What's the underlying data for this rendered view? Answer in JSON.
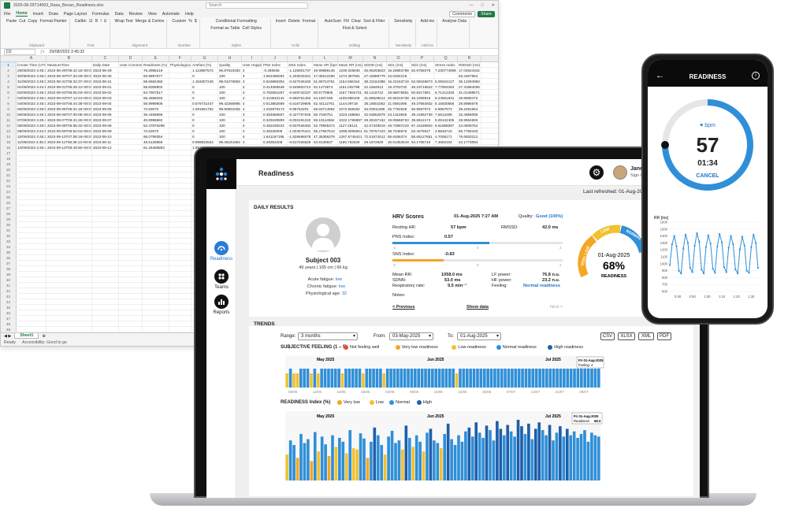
{
  "excel": {
    "file_title": "2025-08-29T14003_Rasa_Bevan_Readiness.xlsx",
    "search_placeholder": "Search",
    "menu_tabs": [
      "File",
      "Home",
      "Insert",
      "Draw",
      "Page Layout",
      "Formulas",
      "Data",
      "Review",
      "View",
      "Automate",
      "Help"
    ],
    "active_tab": "Home",
    "comments_label": "Comments",
    "share_label": "Share",
    "ribbon": [
      {
        "group": "Clipboard",
        "items": [
          "Paste",
          "Cut",
          "Copy",
          "Format Painter"
        ]
      },
      {
        "group": "Font",
        "items": [
          "Calibri",
          "11",
          "B",
          "I",
          "U"
        ]
      },
      {
        "group": "Alignment",
        "items": [
          "Wrap Text",
          "Merge & Centre"
        ]
      },
      {
        "group": "Number",
        "items": [
          "Custom",
          "%",
          "$"
        ]
      },
      {
        "group": "Styles",
        "items": [
          "Conditional Formatting",
          "Format as Table",
          "Cell Styles"
        ]
      },
      {
        "group": "Cells",
        "items": [
          "Insert",
          "Delete",
          "Format"
        ]
      },
      {
        "group": "Editing",
        "items": [
          "AutoSum",
          "Fill",
          "Clear",
          "Sort & Filter",
          "Find & Select"
        ]
      },
      {
        "group": "Sensitivity",
        "items": [
          "Sensitivity"
        ]
      },
      {
        "group": "Add-ins",
        "items": [
          "Add-ins"
        ]
      },
      {
        "group": "",
        "items": [
          "Analyse Data"
        ]
      }
    ],
    "name_box": "D2",
    "formula": "29/08/2023 3:45:32",
    "columns": [
      "A",
      "B",
      "C",
      "D",
      "E",
      "F",
      "G",
      "H",
      "I",
      "J",
      "K",
      "L",
      "M",
      "N",
      "O",
      "P",
      "Q",
      "R",
      "S",
      "T"
    ],
    "headers": [
      "Create Time (UTC)",
      "MeasureTime",
      "Daily Date",
      "User Comment",
      "Readiness (%)",
      "Physiological",
      "Artefact (%)",
      "Quality",
      "User Happiness",
      "PNS Index",
      "SNS Index",
      "Mean HR (bpm)",
      "Mean RR (ms)",
      "SDNN (ms)",
      "SD1 (ms)",
      "SD2 (ms)",
      "Stress Index",
      "RMSSD (ms)"
    ],
    "rows": [
      [
        "29/08/2023 3:45:32",
        "2023-08-29T06:42:15+00:00",
        "2023-08-29",
        "",
        "76.2955219",
        "",
        "1.123897572",
        "96.87610283",
        "4",
        "-0.256936",
        "-1.126001737",
        "49.99888146",
        "1200.026946",
        "45.66293823",
        "16.26883788",
        "62.8755078",
        "7.230774908",
        "17.04624342"
      ],
      [
        "30/08/2023 3:45:04",
        "2023-08-30T07:34:29+00:00",
        "2023-08-30",
        "",
        "93.8897677",
        "",
        "0",
        "100",
        "4",
        "1.562496294",
        "-1.333015341",
        "47.08212256",
        "1274.387591",
        "27.42588779",
        "34.0264218",
        "",
        "",
        "53.4467564"
      ],
      [
        "31/08/2023 3:45:56",
        "2023-08-31T06:32:37+00:00",
        "2023-08-31",
        "",
        "59.6662465",
        "",
        "1.153307245",
        "99.04276963",
        "4",
        "0.616896304",
        "-0.627046183",
        "51.96724761",
        "1154.556154",
        "38.22164388",
        "16.22163719",
        "52.09165873",
        "8.05024127",
        "36.12294983"
      ],
      [
        "01/09/2023 3:44:18",
        "2023-09-01T06:28:12+00:00",
        "2023-09-01",
        "",
        "55.6008802",
        "",
        "0",
        "100",
        "4",
        "0.414065548",
        "-0.546603714",
        "52.1273874",
        "1151.032798",
        "22.1664812",
        "19.3703732",
        "46.23716622",
        "7.77904283",
        "27.31864006"
      ],
      [
        "02/09/2023 3:45:14",
        "2023-09-02T06:55:03+00:00",
        "2023-09-02",
        "",
        "64.7907517",
        "",
        "0",
        "100",
        "4",
        "0.782591257",
        "-0.949742237",
        "50.5770806",
        "1157.7692731",
        "45.1418742",
        "28.98076851",
        "60.8217891",
        "6.71412348",
        "41.01488671"
      ],
      [
        "03/09/2023 3:45:09",
        "2023-09-03T07:12:44+00:00",
        "2023-09-03",
        "",
        "55.4558293",
        "",
        "0",
        "100",
        "4",
        "0.410532142",
        "-0.658761452",
        "54.1507195",
        "1108.858109",
        "31.89629614",
        "20.69316738",
        "46.1009816",
        "8.24561931",
        "28.8869473"
      ],
      [
        "04/09/2023 3:45:06",
        "2023-09-04T06:44:38+00:00",
        "2023-09-04",
        "",
        "58.9999806",
        "",
        "0.576731447",
        "99.42266995",
        "4",
        "0.613862689",
        "-0.616729605",
        "52.44112761",
        "1144.09718",
        "38.18501562",
        "21.0681095",
        "49.37684932",
        "8.15930656",
        "29.8986679"
      ],
      [
        "05/09/2023 3:45:52",
        "2023-09-05T06:31:18+00:00",
        "2023-09-05",
        "",
        "72.63070",
        "",
        "1.091661752",
        "98.90831025",
        "4",
        "1.032876173",
        "-0.98764201",
        "55.83714952",
        "1072.558462",
        "45.00611008",
        "25.7762628",
        "66.9687573",
        "6.8867573",
        "39.2291654"
      ],
      [
        "06/09/2023 3:45:12",
        "2023-09-06T07:00:05+00:00",
        "2023-09-06",
        "",
        "36.4469696",
        "",
        "0",
        "100",
        "4",
        "0.284565507",
        "-0.427707045",
        "60.7040751",
        "1023.168864",
        "32.63552879",
        "23.1310849",
        "39.41982739",
        "7.5612499",
        "33.4958096"
      ],
      [
        "07/09/2023 3:45:41",
        "2023-09-07T06:41:26+00:00",
        "2023-09-07",
        "",
        "40.8995682",
        "",
        "0",
        "100",
        "4",
        "0.329190809",
        "-0.003191222",
        "59.10114562",
        "1022.1765897",
        "29.28197152",
        "19.05568723",
        "39.6612174",
        "9.29122405",
        "26.9554693"
      ],
      [
        "08/09/2023 3:45:08",
        "2023-09-08T06:56:32+00:00",
        "2023-09-08",
        "",
        "52.47876298",
        "",
        "0",
        "100",
        "4",
        "0.482190222",
        "-0.837636462",
        "52.78905374",
        "1127.46121",
        "42.67349519",
        "29.73997219",
        "57.16186504",
        "6.61868097",
        "42.0608764"
      ],
      [
        "09/09/2023 3:44:50",
        "2023-09-09T06:52:04+00:00",
        "2023-09-09",
        "",
        "72.63070",
        "",
        "0",
        "100",
        "4",
        "0.48226009",
        "-1.004675421",
        "55.27567613",
        "1098.0006601",
        "51.78767103",
        "38.7048876",
        "53.4076547",
        "4.8845716",
        "55.7765433"
      ],
      [
        "10/09/2023 3:45:23",
        "2023-09-10T07:06:18+00:00",
        "2023-09-10",
        "",
        "95.0799354",
        "",
        "0",
        "100",
        "4",
        "1.641167195",
        "-1.526698078",
        "47.35356378",
        "1267.6745421",
        "72.51972512",
        "55.6456374",
        "88.66127851",
        "4.7006171",
        "78.6933212"
      ],
      [
        "11/09/2023 3:45:33",
        "2023-09-11T06:38:13+00:00",
        "2023-09-11",
        "",
        "46.5126859",
        "",
        "0.999832524",
        "99.35241964",
        "4",
        "0.29353408",
        "-0.617026828",
        "53.9130837",
        "1155.763229",
        "49.1872929",
        "30.61362519",
        "64.1765716",
        "7.4653104",
        "43.1773094"
      ],
      [
        "12/09/2023 3:45:42",
        "2023-09-12T06:49:50+00:00",
        "2023-09-12",
        "",
        "81.25468853",
        "",
        "1.593847125",
        "98.44513286",
        "4",
        "0.689033058",
        "-1.064675413",
        "",
        "",
        "",
        "",
        "",
        "",
        ""
      ]
    ],
    "extra_row_numbers": [
      17,
      18,
      19,
      20,
      21,
      22,
      23,
      24,
      25,
      26,
      27,
      28,
      29,
      30,
      31,
      32,
      33,
      34,
      35,
      36,
      37,
      38,
      39,
      40,
      41,
      42,
      43,
      44,
      45,
      46,
      47,
      48,
      49
    ],
    "sheet_tab": "Sheet1",
    "status_ready": "Ready",
    "status_access": "Accessibility: Good to go"
  },
  "app": {
    "title": "Readiness",
    "nav": [
      {
        "label": "Readiness",
        "icon": "readiness-icon",
        "active": true
      },
      {
        "label": "Teams",
        "icon": "teams-icon",
        "active": false
      },
      {
        "label": "Reports",
        "icon": "reports-icon",
        "active": false
      }
    ],
    "user_name": "Jane",
    "user_sub": "Sign O",
    "last_refreshed": "Last refreshed: 01-Aug-2025",
    "daily": {
      "section_title": "DAILY RESULTS",
      "subject_name": "Subject 003",
      "subject_meta": "49 years | 165 cm | 66 kg",
      "acute_label": "Acute fatigue:",
      "acute_value": "low",
      "chronic_label": "Chronic fatigue:",
      "chronic_value": "low",
      "phys_label": "Physiological age:",
      "phys_value": "32",
      "hrv_title": "HRV Scores",
      "hrv_datetime": "01-Aug-2025 7:27 AM",
      "quality_label": "Quality:",
      "quality_value": "Good (100%)",
      "resting_hr_label": "Resting HR:",
      "resting_hr_value": "57 bpm",
      "rmssd_label": "RMSSD:",
      "rmssd_value": "42.0 ms",
      "pns_label": "PNS Index:",
      "pns_value": "0.57",
      "pns_fraction": 0.57,
      "sns_label": "SNS Index:",
      "sns_value": "-0.83",
      "sns_fraction": 0.3,
      "bar_ticks": [
        "-2",
        "0",
        "2"
      ],
      "mean_rr_label": "Mean RR:",
      "mean_rr_value": "1058.0 ms",
      "sdnn_label": "SDNN:",
      "sdnn_value": "53.0 ms",
      "resp_label": "Respiratory rate:",
      "resp_value": "9.5 min⁻¹",
      "lf_label": "LF power:",
      "lf_value": "76.8 n.u.",
      "hf_label": "HF power:",
      "hf_value": "23.2 n.u.",
      "feeling_label": "Feeling:",
      "feeling_value": "Normal readiness",
      "notes_label": "Notes:",
      "prev_label": "< Previous",
      "show_data_label": "Show data",
      "next_label": "Next >",
      "gauge_date": "01-Aug-2025",
      "gauge_value": "68%",
      "gauge_percent": 68,
      "gauge_caption": "READINESS",
      "gauge_segments": [
        "VERY LOW",
        "LOW",
        "NORMAL"
      ]
    },
    "trends": {
      "section_title": "TRENDS",
      "range_label": "Range:",
      "range_value": "3 months",
      "from_label": "From:",
      "from_value": "03-May-2025",
      "to_label": "To:",
      "to_value": "01-Aug-2025",
      "exports": [
        "CSV",
        "XLSX",
        "XML",
        "PDF"
      ]
    }
  },
  "chart_data": [
    {
      "type": "bar",
      "title": "SUBJECTIVE FEELING (1 – 5)",
      "legend": [
        "Not feeling well",
        "Very low readiness",
        "Low readiness",
        "Normal readiness",
        "High readiness"
      ],
      "colors": [
        "#e84c3d",
        "#f5a623",
        "#f2c12e",
        "#2f8fd8",
        "#1c5fab"
      ],
      "month_labels": [
        "May 2025",
        "Jun 2025",
        "Jul 2025"
      ],
      "x_ticks": [
        "05/05",
        "12/05",
        "19/05",
        "26/05",
        "02/06",
        "09/06",
        "16/06",
        "23/06",
        "30/06",
        "07/07",
        "14/07",
        "21/07",
        "28/07"
      ],
      "tooltip_date": "Fri 01-Aug-2025",
      "tooltip_text": "Feeling: 4",
      "series": [
        {
          "values": [
            3,
            4,
            3,
            3,
            4,
            4,
            4,
            3,
            4,
            3,
            4,
            4,
            4,
            4,
            4,
            4,
            3,
            4,
            4,
            4,
            4,
            4,
            3,
            4,
            4,
            4,
            4,
            4,
            3,
            4,
            4,
            4,
            4,
            4,
            4,
            4,
            4,
            4,
            4,
            4,
            4,
            4,
            4,
            4,
            4,
            4,
            4,
            4,
            4,
            3,
            4,
            4,
            4,
            4,
            4,
            4,
            4,
            4,
            4,
            4,
            4,
            4,
            4,
            4,
            4,
            4,
            4,
            4,
            4,
            4,
            4,
            4,
            4,
            4,
            4,
            4,
            4,
            4,
            4,
            4,
            4,
            4,
            4,
            4,
            4,
            4,
            4,
            4,
            4,
            4,
            4
          ]
        }
      ]
    },
    {
      "type": "bar",
      "title": "READINESS Index (%)",
      "legend": [
        "Very low",
        "Low",
        "Normal",
        "High"
      ],
      "colors": [
        "#f5a623",
        "#f2c12e",
        "#2f8fd8",
        "#1c5fab"
      ],
      "month_labels": [
        "May 2025",
        "Jun 2025",
        "Jul 2025"
      ],
      "tooltip_date": "Fri 01-Aug-2025",
      "tooltip_label": "Readiness",
      "tooltip_value": "68.3",
      "series": [
        {
          "values": [
            40,
            62,
            55,
            35,
            72,
            58,
            64,
            30,
            75,
            45,
            68,
            56,
            38,
            70,
            52,
            66,
            60,
            42,
            78,
            50,
            48,
            73,
            65,
            35,
            60,
            82,
            70,
            55,
            40,
            68,
            77,
            58,
            62,
            48,
            85,
            66,
            52,
            70,
            60,
            45,
            74,
            80,
            62,
            58,
            50,
            72,
            88,
            64,
            55,
            70,
            60,
            76,
            82,
            68,
            90,
            74,
            66,
            85,
            78,
            62,
            92,
            80,
            70,
            86,
            76,
            68,
            94,
            84,
            72,
            88,
            64,
            80,
            90,
            78,
            70,
            86,
            62,
            74,
            84,
            68,
            80,
            70,
            76,
            66,
            72,
            78,
            60,
            74,
            70,
            68
          ]
        }
      ]
    },
    {
      "type": "line",
      "title": "RR [ms]",
      "ylim": [
        600,
        1600
      ],
      "y_ticks": [
        "1600",
        "1500",
        "1400",
        "1300",
        "1200",
        "1100",
        "1000",
        "900",
        "800",
        "700",
        "600"
      ],
      "x_ticks": [
        "0:40",
        "0:50",
        "1:00",
        "1:10",
        "1:20",
        "1:30"
      ],
      "series": [
        {
          "values": [
            980,
            1280,
            1400,
            1250,
            900,
            860,
            1220,
            1420,
            1300,
            940,
            880,
            1260,
            1440,
            1320,
            920,
            860,
            1240,
            1410,
            1290,
            930,
            870,
            1250,
            1430,
            1310,
            950,
            880,
            1230,
            1400,
            1280,
            920,
            860,
            1210,
            1390,
            1260,
            900,
            870,
            1240,
            1420,
            1300,
            940
          ]
        }
      ]
    },
    {
      "type": "pie",
      "title": "READINESS",
      "bpm_label": "bpm",
      "bpm_value": "57",
      "elapsed": "01:34",
      "cancel_label": "CANCEL",
      "progress_fraction": 0.75
    }
  ]
}
